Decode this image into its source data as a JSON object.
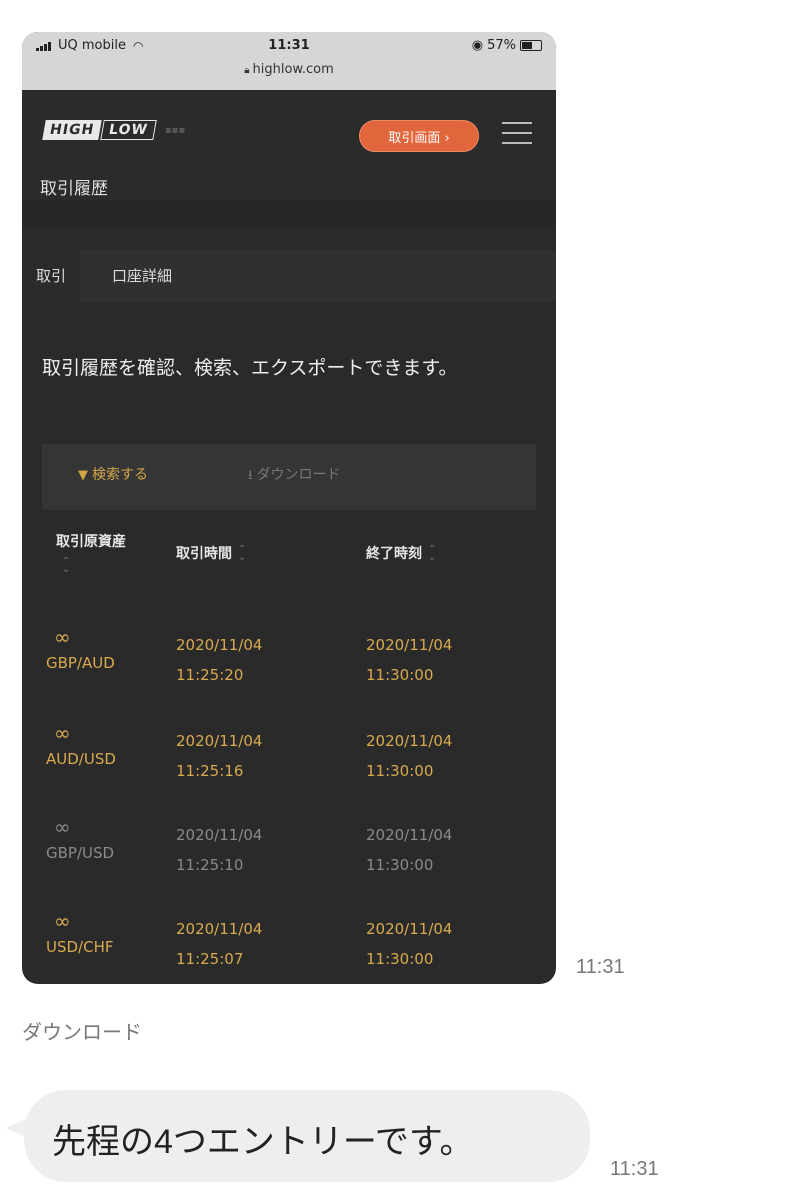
{
  "screenshot": {
    "status_bar": {
      "carrier": "UQ mobile",
      "time": "11:31",
      "battery": "57%",
      "battery_fraction": 0.57,
      "url": "highlow.com"
    },
    "header": {
      "logo_high": "HIGH",
      "logo_low": "LOW",
      "trade_button": "取引画面 ›",
      "page_title": "取引履歴"
    },
    "tabs": [
      {
        "label": "取引"
      },
      {
        "label": "口座詳細"
      }
    ],
    "intro": "取引履歴を確認、検索、エクスポートできます。",
    "actions": {
      "search": "検索する",
      "download": "ダウンロード"
    },
    "table": {
      "headers": [
        "取引原資産",
        "取引時間",
        "終了時刻"
      ],
      "rows": [
        {
          "asset": "GBP/AUD",
          "trade_time_date": "2020/11/04",
          "trade_time_clock": "11:25:20",
          "end_time_date": "2020/11/04",
          "end_time_clock": "11:30:00",
          "status": "gold"
        },
        {
          "asset": "AUD/USD",
          "trade_time_date": "2020/11/04",
          "trade_time_clock": "11:25:16",
          "end_time_date": "2020/11/04",
          "end_time_clock": "11:30:00",
          "status": "gold"
        },
        {
          "asset": "GBP/USD",
          "trade_time_date": "2020/11/04",
          "trade_time_clock": "11:25:10",
          "end_time_date": "2020/11/04",
          "end_time_clock": "11:30:00",
          "status": "gray"
        },
        {
          "asset": "USD/CHF",
          "trade_time_date": "2020/11/04",
          "trade_time_clock": "11:25:07",
          "end_time_date": "2020/11/04",
          "end_time_clock": "11:30:00",
          "status": "gold"
        }
      ]
    }
  },
  "chat": {
    "image_time": "11:31",
    "caption": "ダウンロード",
    "message": "先程の4つエントリーです。",
    "message_time": "11:31"
  },
  "colors": {
    "accent_orange": "#e2663c",
    "gold": "#d8aa4f",
    "dark_bg": "#2a2a2a"
  }
}
